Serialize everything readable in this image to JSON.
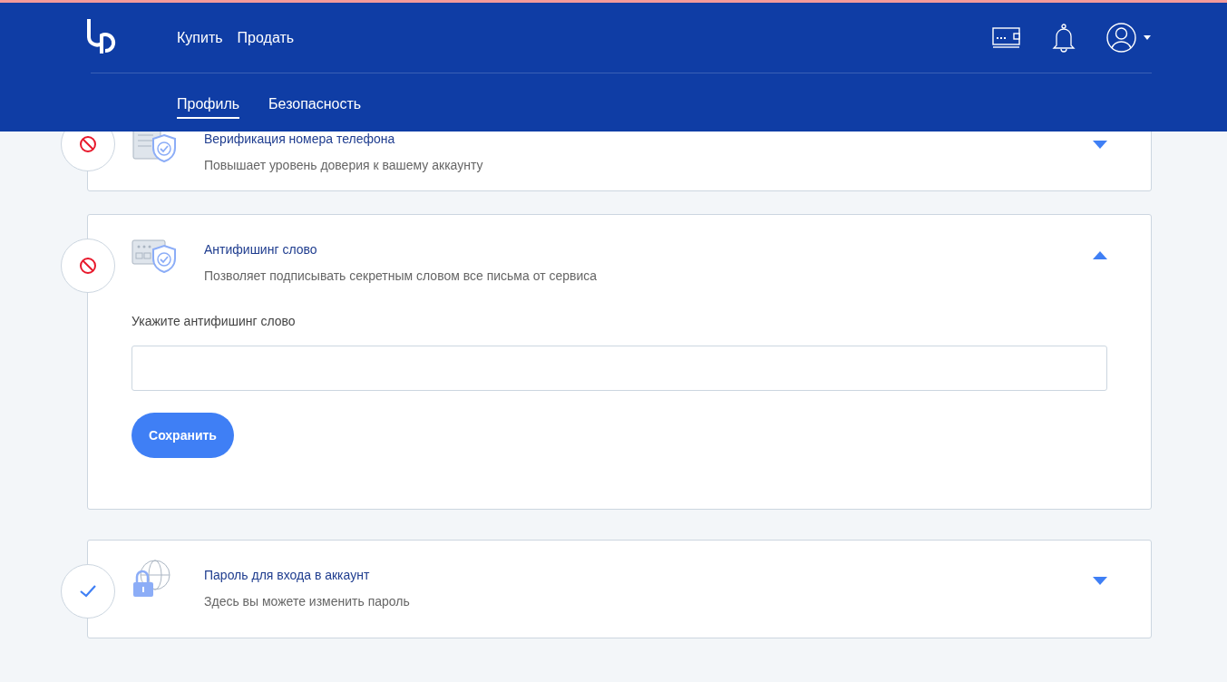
{
  "header": {
    "nav": [
      {
        "label": "Купить"
      },
      {
        "label": "Продать"
      }
    ],
    "tabs": [
      {
        "label": "Профиль",
        "selected": true
      },
      {
        "label": "Безопасность",
        "selected": false
      }
    ]
  },
  "sections": [
    {
      "verified": false,
      "title": "Верификация номера телефона",
      "subtitle": "Повышает уровень доверия к вашему аккаунту",
      "expanded": false
    },
    {
      "verified": false,
      "title": "Антифишинг слово",
      "subtitle": "Позволяет подписывать секретным словом все письма от сервиса",
      "expanded": true,
      "field_label": "Укажите антифишинг слово",
      "button": "Сохранить"
    },
    {
      "verified": true,
      "title": "Пароль для входа в аккаунт",
      "subtitle": "Здесь вы можете изменить пароль",
      "expanded": false
    }
  ]
}
